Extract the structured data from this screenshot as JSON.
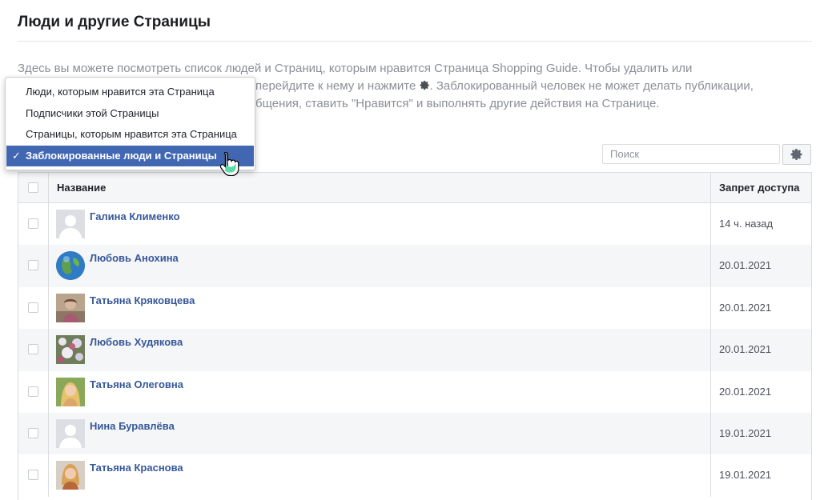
{
  "header": {
    "title": "Люди и другие Страницы"
  },
  "description": {
    "line1": "Здесь вы можете посмотреть список людей и Страниц, которым нравится Страница Shopping Guide. Чтобы удалить или",
    "line2_visible": "перейдите к нему и нажмите",
    "line2_after": ". Заблокированный человек не может делать публикации,",
    "line3_visible": "бщения, ставить \"Нравится\" и выполнять другие действия на Странице."
  },
  "dropdown": {
    "items": [
      {
        "label": "Люди, которым нравится эта Страница",
        "selected": false
      },
      {
        "label": "Подписчики этой Страницы",
        "selected": false
      },
      {
        "label": "Страницы, которым нравится эта Страница",
        "selected": false
      },
      {
        "label": "Заблокированные люди и Страницы",
        "selected": true
      }
    ],
    "checkmark": "✓"
  },
  "search": {
    "placeholder": "Поиск",
    "value": ""
  },
  "table": {
    "columns": {
      "name": "Название",
      "date": "Запрет доступа"
    },
    "rows": [
      {
        "name": "Галина Клименко",
        "date": "14 ч. назад",
        "avatar": "default-silhouette"
      },
      {
        "name": "Любовь Анохина",
        "date": "20.01.2021",
        "avatar": "globe"
      },
      {
        "name": "Татьяна Кряковцева",
        "date": "20.01.2021",
        "avatar": "photo"
      },
      {
        "name": "Любовь Худякова",
        "date": "20.01.2021",
        "avatar": "photo-flowers"
      },
      {
        "name": "Татьяна Олеговна",
        "date": "20.01.2021",
        "avatar": "photo-blonde"
      },
      {
        "name": "Нина Буравлёва",
        "date": "19.01.2021",
        "avatar": "default-silhouette"
      },
      {
        "name": "Татьяна Краснова",
        "date": "19.01.2021",
        "avatar": "photo-blonde"
      }
    ]
  },
  "colors": {
    "link": "#365899",
    "selected_bg": "#4267b2",
    "row_alt": "#f5f6f7"
  }
}
